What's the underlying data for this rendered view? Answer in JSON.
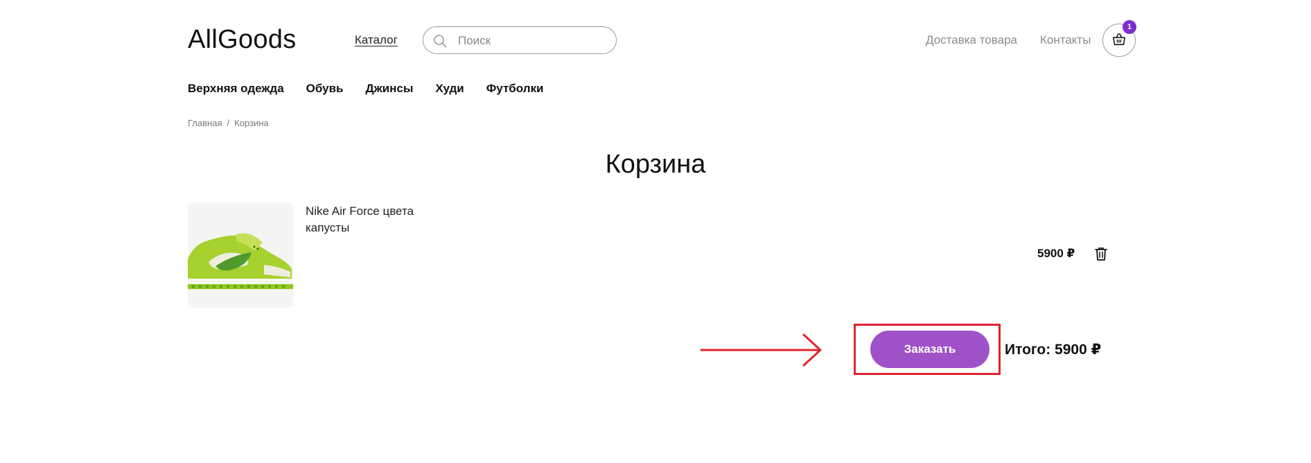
{
  "header": {
    "logo": "AllGoods",
    "catalog_label": "Каталог",
    "search_placeholder": "Поиск",
    "delivery_label": "Доставка товара",
    "contacts_label": "Контакты",
    "cart_count": "1"
  },
  "categories": [
    "Верхняя одежда",
    "Обувь",
    "Джинсы",
    "Худи",
    "Футболки"
  ],
  "breadcrumb": {
    "home": "Главная",
    "separator": "/",
    "current": "Корзина"
  },
  "page_title": "Корзина",
  "cart_item": {
    "name_line1": "Nike Air Force цвета",
    "name_line2": "капусты",
    "price": "5900 ₽"
  },
  "order_button_label": "Заказать",
  "total": "Итого: 5900 ₽",
  "colors": {
    "accent_purple": "#9f52c8",
    "badge_purple": "#7b2fcf",
    "annotation_red": "#e0232e"
  }
}
